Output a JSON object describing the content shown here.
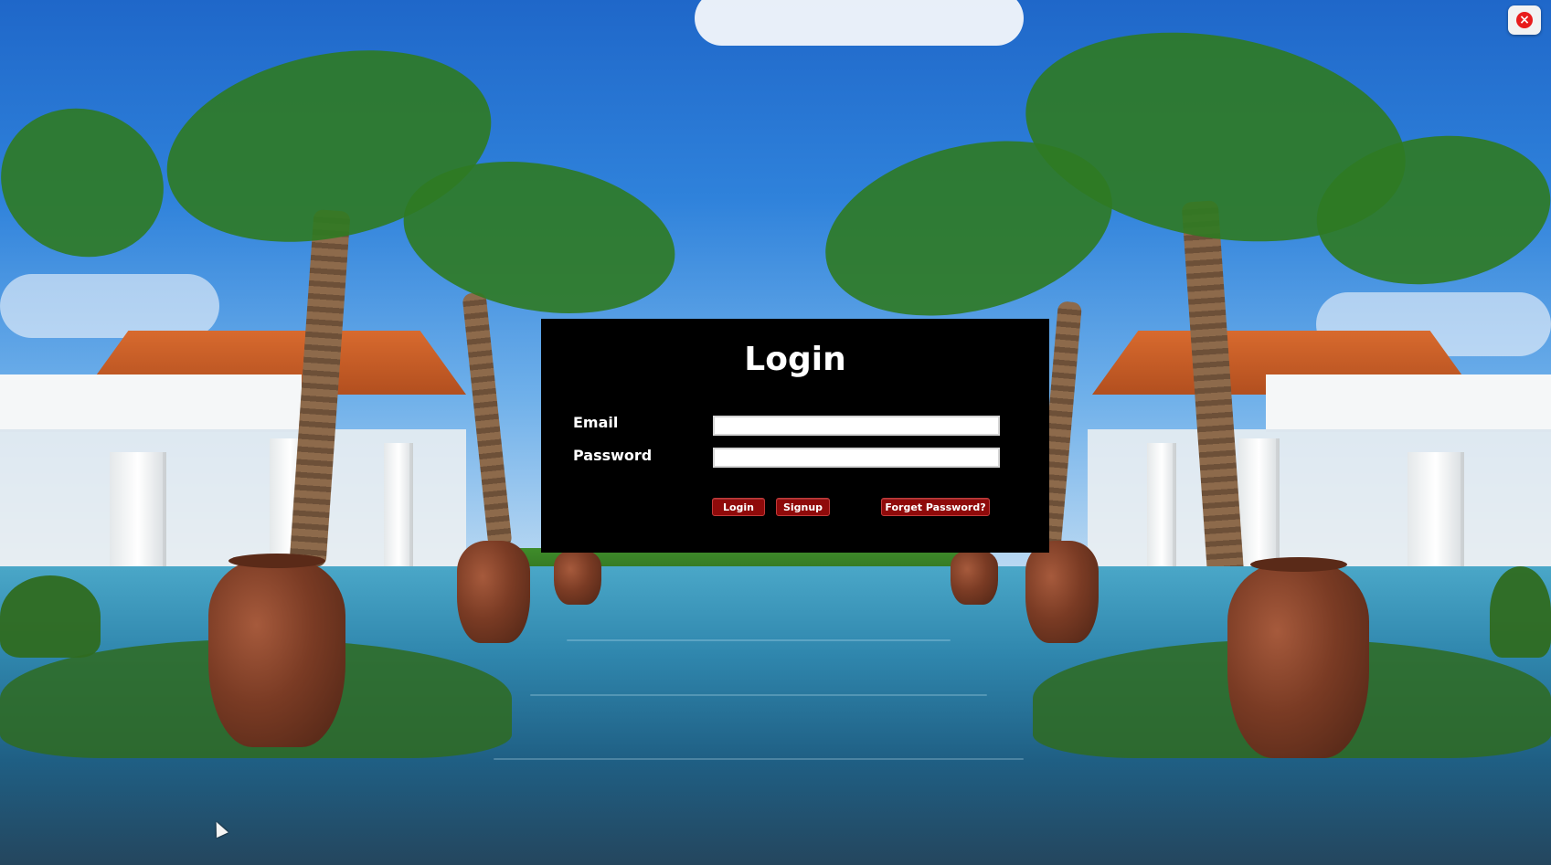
{
  "window": {
    "close_icon": "close-circle-icon",
    "close_glyph": "×",
    "accent_color": "#e81c1c"
  },
  "login": {
    "title": "Login",
    "email_label": "Email",
    "email_value": "",
    "password_label": "Password",
    "password_value": "",
    "login_button": "Login",
    "signup_button": "Signup",
    "forgot_button": "Forget Password?",
    "button_color": "#8f0a0a",
    "panel_color": "#000000"
  },
  "background": {
    "icon": "resort-pool-photo-icon"
  }
}
